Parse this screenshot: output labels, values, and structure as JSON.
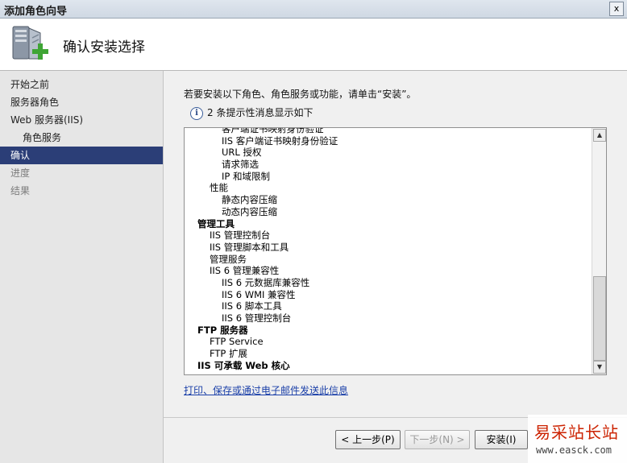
{
  "window": {
    "title": "添加角色向导",
    "close_glyph": "x"
  },
  "header": {
    "page_title": "确认安装选择",
    "icon": "server-add-role-icon"
  },
  "sidebar": {
    "items": [
      {
        "label": "开始之前",
        "state": "normal"
      },
      {
        "label": "服务器角色",
        "state": "normal"
      },
      {
        "label": "Web 服务器(IIS)",
        "state": "normal"
      },
      {
        "label": "角色服务",
        "state": "normal",
        "indent": true
      },
      {
        "label": "确认",
        "state": "active"
      },
      {
        "label": "进度",
        "state": "disabled"
      },
      {
        "label": "结果",
        "state": "disabled"
      }
    ]
  },
  "main": {
    "instruction": "若要安装以下角色、角色服务或功能，请单击“安装”。",
    "info_icon": "i",
    "info_text": "2 条提示性消息显示如下",
    "tree": [
      {
        "label": "客户端证书映射身份验证",
        "level": 2
      },
      {
        "label": "IIS 客户端证书映射身份验证",
        "level": 2
      },
      {
        "label": "URL 授权",
        "level": 2
      },
      {
        "label": "请求筛选",
        "level": 2
      },
      {
        "label": "IP 和域限制",
        "level": 2
      },
      {
        "label": "性能",
        "level": 1
      },
      {
        "label": "静态内容压缩",
        "level": 2
      },
      {
        "label": "动态内容压缩",
        "level": 2
      },
      {
        "label": "管理工具",
        "level": 0
      },
      {
        "label": "IIS 管理控制台",
        "level": 1
      },
      {
        "label": "IIS 管理脚本和工具",
        "level": 1
      },
      {
        "label": "管理服务",
        "level": 1
      },
      {
        "label": "IIS 6 管理兼容性",
        "level": 1
      },
      {
        "label": "IIS 6 元数据库兼容性",
        "level": 2
      },
      {
        "label": "IIS 6 WMI 兼容性",
        "level": 2
      },
      {
        "label": "IIS 6 脚本工具",
        "level": 2
      },
      {
        "label": "IIS 6 管理控制台",
        "level": 2
      },
      {
        "label": "FTP 服务器",
        "level": 0
      },
      {
        "label": "FTP Service",
        "level": 1
      },
      {
        "label": "FTP 扩展",
        "level": 1
      },
      {
        "label": "IIS 可承载 Web 核心",
        "level": 0
      }
    ],
    "scroll_up_glyph": "▲",
    "scroll_down_glyph": "▼",
    "link_text": "打印、保存或通过电子邮件发送此信息"
  },
  "footer": {
    "prev_label": "< 上一步(P)",
    "next_label": "下一步(N) >",
    "install_label": "安装(I)"
  },
  "watermark": {
    "title": "易采站长站",
    "url": "www.easck.com"
  }
}
